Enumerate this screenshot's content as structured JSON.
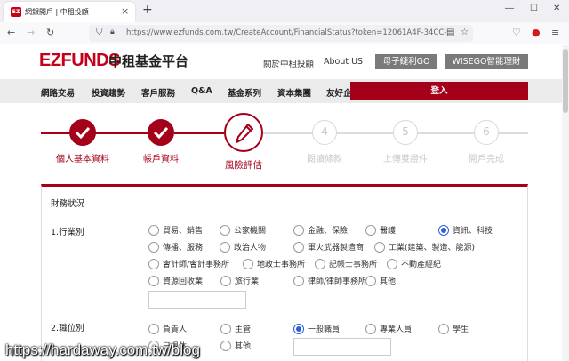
{
  "browser": {
    "tab_title": "網銀開戶 | 中租投顧",
    "favicon_text": "EZ",
    "url": "https://www.ezfunds.com.tw/CreateAccount/FinancialStatus?token=12061A4F-34CC-4B07-"
  },
  "header": {
    "logo": "EZFUNDS",
    "logo_cn": "中租基金平台",
    "links": [
      "關於中租投顧",
      "About US"
    ],
    "buttons": [
      "母子鏈利GO",
      "WISEGO智能理財"
    ]
  },
  "menu": {
    "items": [
      "網路交易",
      "投資趨勢",
      "客戶服務",
      "Q&A",
      "基金系列",
      "資本集團",
      "友好企業"
    ],
    "login": "登入"
  },
  "steps": [
    {
      "label": "個人基本資料",
      "state": "done"
    },
    {
      "label": "帳戶資料",
      "state": "done"
    },
    {
      "label": "風險評估",
      "state": "current"
    },
    {
      "num": "4",
      "label": "閱讀條款",
      "state": "todo"
    },
    {
      "num": "5",
      "label": "上傳雙證件",
      "state": "todo"
    },
    {
      "num": "6",
      "label": "開戶完成",
      "state": "todo"
    }
  ],
  "form": {
    "section_title": "財務狀況",
    "q1": {
      "label": "1.行業別",
      "selected": "資訊、科技",
      "options": [
        "貿易、銷售",
        "公家機關",
        "金融、保險",
        "醫護",
        "資訊、科技",
        "傳播、服務",
        "政治人物",
        "軍火武器製造商",
        "工業(建築、製造、能源)",
        "會計師/會計事務所",
        "地政士事務所",
        "記帳士事務所",
        "不動產經紀",
        "資源回收業",
        "旅行業",
        "律師/律師事務所",
        "其他"
      ],
      "other_value": ""
    },
    "q2": {
      "label": "2.職位別",
      "selected": "一般職員",
      "options": [
        "負責人",
        "主管",
        "一般職員",
        "專業人員",
        "學生",
        "已退休",
        "其他"
      ],
      "other_value": ""
    }
  },
  "colors": {
    "brand": "#a5001a",
    "radio_selected": "#2b5fd9"
  },
  "watermark": "https://hardaway.com.tw/blog"
}
